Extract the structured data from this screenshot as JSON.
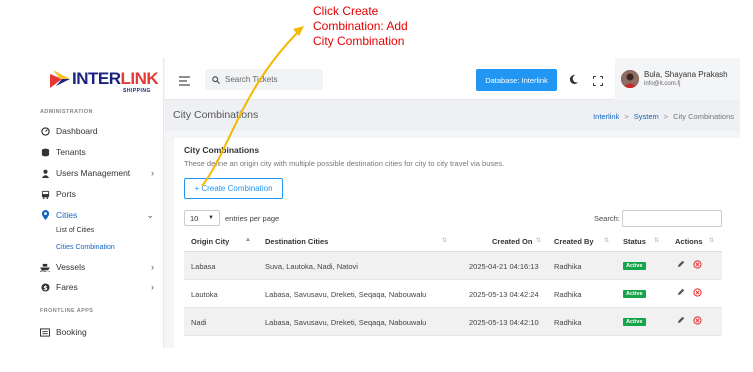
{
  "annotation": {
    "text": "Click Create\nCombination:  Add\nCity Combination",
    "color": "#e60000"
  },
  "brand": {
    "name_a": "INTER",
    "name_b": "LINK",
    "tagline": "SHIPPING"
  },
  "sidebar": {
    "section_admin": "ADMINISTRATION",
    "items": [
      {
        "label": "Dashboard",
        "icon": "speedometer-icon"
      },
      {
        "label": "Tenants",
        "icon": "database-icon"
      },
      {
        "label": "Users Management",
        "icon": "user-icon",
        "chevron": "›"
      },
      {
        "label": "Ports",
        "icon": "bus-icon"
      },
      {
        "label": "Cities",
        "icon": "map-pin-icon",
        "chevron": "⌄"
      },
      {
        "label": "Vessels",
        "icon": "ship-icon",
        "chevron": "›"
      },
      {
        "label": "Fares",
        "icon": "dollar-icon",
        "chevron": "›"
      }
    ],
    "sub_items": [
      {
        "label": "List of Cities"
      },
      {
        "label": "Cities Combination"
      }
    ],
    "section_frontline": "FRONTLINE APPS",
    "booking": {
      "label": "Booking",
      "icon": "booking-icon"
    }
  },
  "topbar": {
    "search_placeholder": "Search Tickets",
    "db_button": "Database: Interlink",
    "user_name": "Bula, Shayana Prakash",
    "user_email": "info@it.com.fj"
  },
  "pageheader": {
    "title": "City Combinations",
    "breadcrumb": [
      "Interlink",
      "System",
      "City Combinations"
    ],
    "separator": ">"
  },
  "card": {
    "title": "City Combinations",
    "description": "These define an origin city with multiple possible destination cities for city to city travel via buses.",
    "create_button": "+ Create Combination"
  },
  "table_controls": {
    "page_length": "10",
    "entries_label": "entries per page",
    "search_label": "Search:"
  },
  "table": {
    "headers": [
      "Origin City",
      "Destination Cities",
      "Created On",
      "Created By",
      "Status",
      "Actions"
    ],
    "rows": [
      {
        "origin": "Labasa",
        "destinations": "Suva, Lautoka, Nadi, Natovi",
        "created_on": "2025-04-21 04:16:13",
        "created_by": "Radhika",
        "status": "Active"
      },
      {
        "origin": "Lautoka",
        "destinations": "Labasa, Savusavu, Dreketi, Seqaqa, Nabouwalu",
        "created_on": "2025-05-13 04:42:24",
        "created_by": "Radhika",
        "status": "Active"
      },
      {
        "origin": "Nadi",
        "destinations": "Labasa, Savusavu, Dreketi, Seqaqa, Nabouwalu",
        "created_on": "2025-05-13 04:42:10",
        "created_by": "Radhika",
        "status": "Active"
      }
    ]
  },
  "colors": {
    "primary": "#2196f3",
    "active_badge": "#17a34a",
    "danger": "#e53935",
    "annotation_arrow": "#f5b800"
  }
}
